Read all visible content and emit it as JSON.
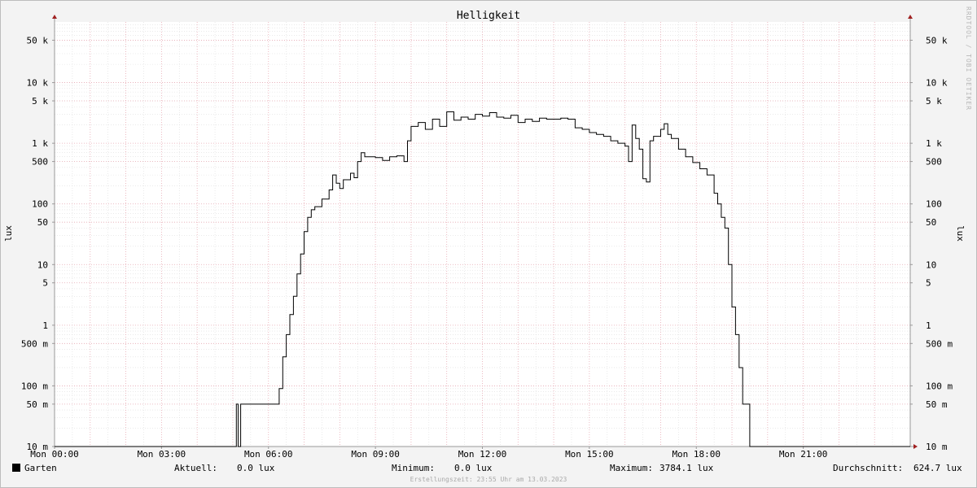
{
  "chart_data": {
    "type": "line",
    "title": "Helligkeit",
    "ylabel": "lux",
    "yscale": "log",
    "ylim": [
      0.01,
      100000
    ],
    "y_ticks": [
      {
        "value": 50000,
        "label": "50 k"
      },
      {
        "value": 10000,
        "label": "10 k"
      },
      {
        "value": 5000,
        "label": "5 k"
      },
      {
        "value": 1000,
        "label": "1 k"
      },
      {
        "value": 500,
        "label": "500"
      },
      {
        "value": 100,
        "label": "100"
      },
      {
        "value": 50,
        "label": "50"
      },
      {
        "value": 10,
        "label": "10"
      },
      {
        "value": 5,
        "label": "5"
      },
      {
        "value": 1,
        "label": "1"
      },
      {
        "value": 0.5,
        "label": "500 m"
      },
      {
        "value": 0.1,
        "label": "100 m"
      },
      {
        "value": 0.05,
        "label": "50 m"
      },
      {
        "value": 0.01,
        "label": "10 m"
      }
    ],
    "x_unit": "hours",
    "xlim": [
      0,
      24
    ],
    "x_ticks": [
      {
        "value": 0,
        "label": "Mon 00:00"
      },
      {
        "value": 3,
        "label": "Mon 03:00"
      },
      {
        "value": 6,
        "label": "Mon 06:00"
      },
      {
        "value": 9,
        "label": "Mon 09:00"
      },
      {
        "value": 12,
        "label": "Mon 12:00"
      },
      {
        "value": 15,
        "label": "Mon 15:00"
      },
      {
        "value": 18,
        "label": "Mon 18:00"
      },
      {
        "value": 21,
        "label": "Mon 21:00"
      }
    ],
    "grid": true,
    "series": [
      {
        "name": "Garten",
        "color": "#000000",
        "points": [
          [
            0,
            0.01
          ],
          [
            5.1,
            0.01
          ],
          [
            5.1,
            0.05
          ],
          [
            5.15,
            0.05
          ],
          [
            5.15,
            0.01
          ],
          [
            5.22,
            0.01
          ],
          [
            5.22,
            0.05
          ],
          [
            6.3,
            0.05
          ],
          [
            6.3,
            0.09
          ],
          [
            6.4,
            0.3
          ],
          [
            6.5,
            0.7
          ],
          [
            6.6,
            1.5
          ],
          [
            6.7,
            3
          ],
          [
            6.8,
            7
          ],
          [
            6.9,
            15
          ],
          [
            7.0,
            35
          ],
          [
            7.1,
            60
          ],
          [
            7.2,
            80
          ],
          [
            7.3,
            90
          ],
          [
            7.5,
            120
          ],
          [
            7.7,
            170
          ],
          [
            7.8,
            300
          ],
          [
            7.9,
            220
          ],
          [
            8.0,
            180
          ],
          [
            8.1,
            250
          ],
          [
            8.3,
            320
          ],
          [
            8.4,
            270
          ],
          [
            8.5,
            500
          ],
          [
            8.6,
            700
          ],
          [
            8.7,
            600
          ],
          [
            9.0,
            580
          ],
          [
            9.2,
            520
          ],
          [
            9.4,
            600
          ],
          [
            9.6,
            620
          ],
          [
            9.8,
            500
          ],
          [
            9.9,
            1100
          ],
          [
            10.0,
            1900
          ],
          [
            10.2,
            2200
          ],
          [
            10.4,
            1700
          ],
          [
            10.6,
            2500
          ],
          [
            10.8,
            1900
          ],
          [
            11.0,
            3300
          ],
          [
            11.2,
            2400
          ],
          [
            11.4,
            2700
          ],
          [
            11.6,
            2500
          ],
          [
            11.8,
            3000
          ],
          [
            12.0,
            2800
          ],
          [
            12.2,
            3200
          ],
          [
            12.4,
            2700
          ],
          [
            12.6,
            2600
          ],
          [
            12.8,
            2900
          ],
          [
            13.0,
            2200
          ],
          [
            13.2,
            2500
          ],
          [
            13.4,
            2300
          ],
          [
            13.6,
            2600
          ],
          [
            13.8,
            2500
          ],
          [
            14.0,
            2500
          ],
          [
            14.2,
            2600
          ],
          [
            14.4,
            2500
          ],
          [
            14.6,
            1800
          ],
          [
            14.8,
            1700
          ],
          [
            15.0,
            1500
          ],
          [
            15.2,
            1400
          ],
          [
            15.4,
            1300
          ],
          [
            15.6,
            1100
          ],
          [
            15.8,
            1000
          ],
          [
            16.0,
            900
          ],
          [
            16.1,
            500
          ],
          [
            16.2,
            2000
          ],
          [
            16.3,
            1200
          ],
          [
            16.4,
            800
          ],
          [
            16.5,
            260
          ],
          [
            16.6,
            230
          ],
          [
            16.7,
            1100
          ],
          [
            16.8,
            1300
          ],
          [
            17.0,
            1700
          ],
          [
            17.1,
            2100
          ],
          [
            17.2,
            1400
          ],
          [
            17.3,
            1200
          ],
          [
            17.5,
            800
          ],
          [
            17.7,
            600
          ],
          [
            17.9,
            480
          ],
          [
            18.1,
            380
          ],
          [
            18.3,
            300
          ],
          [
            18.5,
            150
          ],
          [
            18.6,
            100
          ],
          [
            18.7,
            60
          ],
          [
            18.8,
            40
          ],
          [
            18.9,
            10
          ],
          [
            19.0,
            2
          ],
          [
            19.1,
            0.7
          ],
          [
            19.2,
            0.2
          ],
          [
            19.3,
            0.05
          ],
          [
            19.5,
            0.05
          ],
          [
            19.5,
            0.01
          ],
          [
            24,
            0.01
          ]
        ]
      }
    ],
    "legend": "bottom-left"
  },
  "legend": {
    "swatch_color": "#000000",
    "series_name": "Garten",
    "aktuell_label": "Aktuell:",
    "aktuell_value": "0.0 lux",
    "minimum_label": "Minimum:",
    "minimum_value": "0.0 lux",
    "maximum_label": "Maximum:",
    "maximum_value": "3784.1 lux",
    "durchschnitt_label": "Durchschnitt:",
    "durchschnitt_value": "624.7 lux"
  },
  "credit": "RRDTOOL / TOBI OETIKER",
  "footer": "Erstellungszeit: 23:55 Uhr am 13.03.2023",
  "colors": {
    "minor_grid": "#dddddd",
    "major_grid": "#e8aab4",
    "axis": "#9a9a9a",
    "arrow": "#a02020"
  }
}
